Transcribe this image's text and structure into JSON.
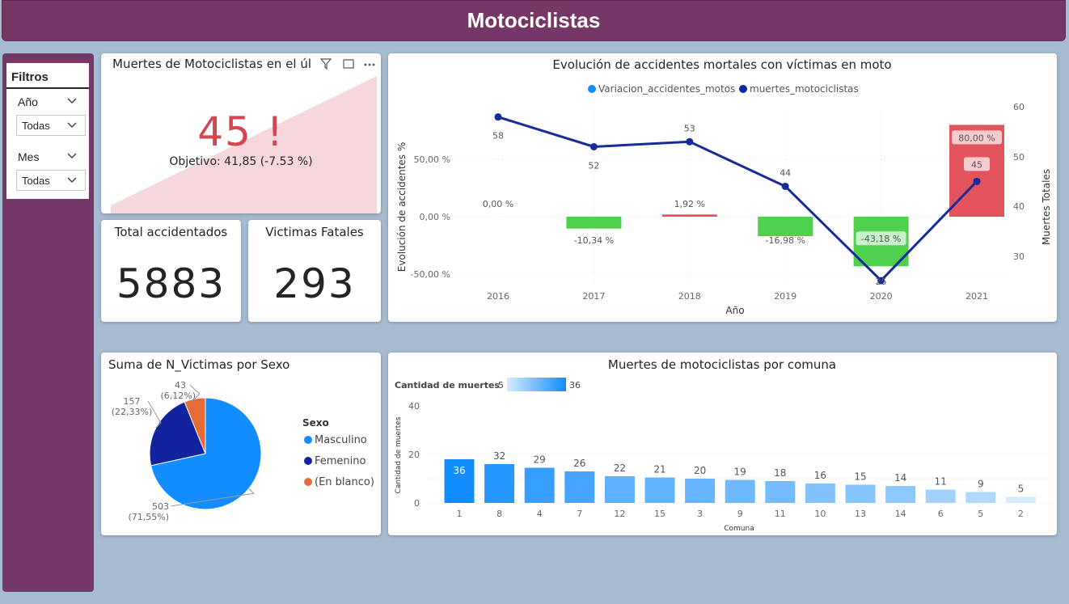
{
  "page": {
    "title": "Motociclistas"
  },
  "filters": {
    "title": "Filtros",
    "year": {
      "label": "Año",
      "value": "Todas"
    },
    "month": {
      "label": "Mes",
      "value": "Todas"
    }
  },
  "kpi": {
    "title": "Muertes de Motociclistas en el úl",
    "value": "45 !",
    "target": "Objetivo: 41,85 (-7.53 %)",
    "value_color": "#d64550"
  },
  "cards": {
    "total": {
      "title": "Total accidentados",
      "value": "5883"
    },
    "fatal": {
      "title": "Victimas Fatales",
      "value": "293"
    }
  },
  "combo": {
    "title": "Evolución de accidentes mortales con víctimas en moto",
    "legend": [
      "Variacion_accidentes_motos",
      "muertes_motociclistas"
    ],
    "xlabel": "Año",
    "ylabel_left": "Evolución de accidentes %",
    "ylabel_right": "Muertes Totales",
    "left_ticks": [
      "50,00 %",
      "0,00 %",
      "-50,00 %"
    ],
    "right_ticks": [
      "60",
      "50",
      "40",
      "30"
    ]
  },
  "pie": {
    "title": "Suma de N_Victimas por Sexo",
    "legend_title": "Sexo"
  },
  "bars": {
    "title": "Muertes de motociclistas por comuna",
    "scale_label": "Cantidad de muertes",
    "scale_min": "5",
    "scale_max": "36",
    "xlabel": "Comuna",
    "ylabel": "Cantidad de muertes",
    "y_ticks": [
      "40",
      "20",
      "0"
    ]
  },
  "chart_data": [
    {
      "type": "bar",
      "title": "Evolución de accidentes mortales con víctimas en moto",
      "xlabel": "Año",
      "ylabel": "Evolución de accidentes %",
      "categories": [
        "2016",
        "2017",
        "2018",
        "2019",
        "2020",
        "2021"
      ],
      "series": [
        {
          "name": "Variacion_accidentes_motos",
          "values": [
            0,
            -10.34,
            1.92,
            -16.98,
            -43.18,
            80.0
          ],
          "labels": [
            "0,00 %",
            "-10,34 %",
            "1,92 %",
            "-16,98 %",
            "-43,18 %",
            "80,00 %"
          ]
        },
        {
          "name": "muertes_motociclistas",
          "values": [
            58,
            52,
            53,
            44,
            25,
            45
          ]
        }
      ],
      "ylim_left": [
        -50,
        80
      ],
      "ylim_right": [
        25,
        60
      ],
      "colors": {
        "positive": "#e3545c",
        "negative": "#4fd14f",
        "line": "#1a2a99"
      }
    },
    {
      "type": "pie",
      "title": "Suma de N_Victimas por Sexo",
      "categories": [
        "Masculino",
        "Femenino",
        "(En blanco)"
      ],
      "values": [
        503,
        157,
        43
      ],
      "labels": [
        "503\n(71,55%)",
        "157\n(22,33%)",
        "43\n(6,12%)"
      ],
      "colors": [
        "#118dff",
        "#12239e",
        "#e66c37"
      ],
      "legend": "right"
    },
    {
      "type": "bar",
      "title": "Muertes de motociclistas por comuna",
      "xlabel": "Comuna",
      "ylabel": "Cantidad de muertes",
      "categories": [
        "1",
        "8",
        "4",
        "7",
        "12",
        "15",
        "3",
        "9",
        "11",
        "10",
        "13",
        "14",
        "6",
        "5",
        "2"
      ],
      "values": [
        36,
        32,
        29,
        26,
        22,
        21,
        20,
        19,
        18,
        16,
        15,
        14,
        11,
        9,
        5
      ],
      "ylim": [
        0,
        40
      ],
      "colors": {
        "min": "#d7ebff",
        "max": "#118dff"
      }
    }
  ]
}
